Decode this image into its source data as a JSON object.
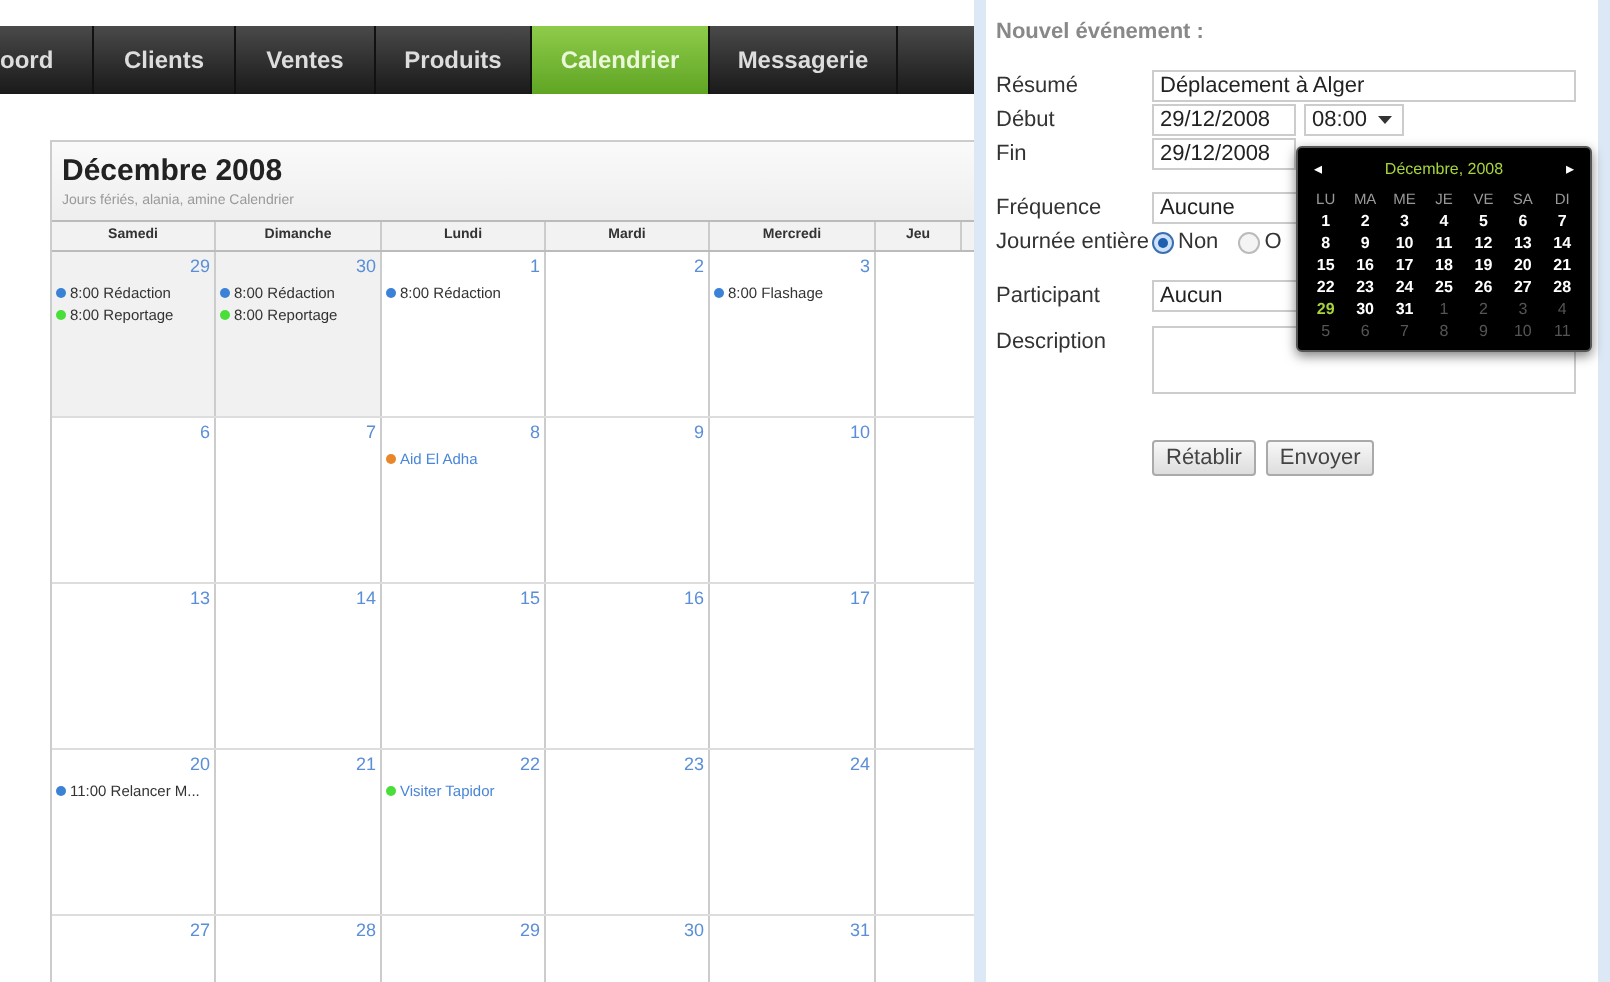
{
  "nav": {
    "tabs": [
      {
        "label": "oord",
        "selected": false
      },
      {
        "label": "Clients",
        "selected": false
      },
      {
        "label": "Ventes",
        "selected": false
      },
      {
        "label": "Produits",
        "selected": false
      },
      {
        "label": "Calendrier",
        "selected": true
      },
      {
        "label": "Messagerie",
        "selected": false
      }
    ]
  },
  "calendar": {
    "title": "Décembre 2008",
    "subtitle": "Jours fériés, alania, amine Calendrier",
    "columns": [
      "Samedi",
      "Dimanche",
      "Lundi",
      "Mardi",
      "Mercredi",
      "Jeu"
    ],
    "weeks": [
      {
        "days": [
          {
            "number": "29",
            "past": true,
            "events": [
              {
                "kind": "event",
                "text": "8:00 Rédaction",
                "color": "#3b82d6"
              },
              {
                "kind": "event",
                "text": "8:00 Reportage",
                "color": "#4ade3a"
              }
            ]
          },
          {
            "number": "30",
            "past": true,
            "events": [
              {
                "kind": "event",
                "text": "8:00 Rédaction",
                "color": "#3b82d6"
              },
              {
                "kind": "event",
                "text": "8:00 Reportage",
                "color": "#4ade3a"
              }
            ]
          },
          {
            "number": "1",
            "past": false,
            "events": [
              {
                "kind": "event",
                "text": "8:00 Rédaction",
                "color": "#3b82d6"
              }
            ]
          },
          {
            "number": "2",
            "past": false
          },
          {
            "number": "3",
            "past": false,
            "events": [
              {
                "kind": "event",
                "text": "8:00 Flashage",
                "color": "#3b82d6"
              }
            ]
          }
        ]
      },
      {
        "days": [
          {
            "number": "6",
            "past": false
          },
          {
            "number": "7",
            "past": false
          },
          {
            "number": "8",
            "past": false,
            "events": [
              {
                "kind": "holiday",
                "text": "Aid El Adha",
                "color": "#e8862a"
              }
            ]
          },
          {
            "number": "9",
            "past": false
          },
          {
            "number": "10",
            "past": false
          }
        ]
      },
      {
        "days": [
          {
            "number": "13",
            "past": false
          },
          {
            "number": "14",
            "past": false
          },
          {
            "number": "15",
            "past": false
          },
          {
            "number": "16",
            "past": false
          },
          {
            "number": "17",
            "past": false
          }
        ]
      },
      {
        "days": [
          {
            "number": "20",
            "past": false,
            "events": [
              {
                "kind": "event",
                "text": "11:00 Relancer M...",
                "color": "#3b82d6"
              }
            ]
          },
          {
            "number": "21",
            "past": false
          },
          {
            "number": "22",
            "past": false,
            "events": [
              {
                "kind": "holiday",
                "text": "Visiter Tapidor",
                "color": "#4ade3a"
              }
            ]
          },
          {
            "number": "23",
            "past": false
          },
          {
            "number": "24",
            "past": false
          }
        ]
      },
      {
        "days": [
          {
            "number": "27",
            "past": false
          },
          {
            "number": "28",
            "past": false
          },
          {
            "number": "29",
            "past": false
          },
          {
            "number": "30",
            "past": false
          },
          {
            "number": "31",
            "past": false
          }
        ]
      }
    ]
  },
  "form": {
    "title": "Nouvel événement :",
    "summary": {
      "label": "Résumé",
      "value": "Déplacement à Alger"
    },
    "start": {
      "label": "Début",
      "date": "29/12/2008",
      "time": "08:00"
    },
    "end": {
      "label": "Fin",
      "date": "29/12/2008"
    },
    "frequency": {
      "label": "Fréquence",
      "value": "Aucune"
    },
    "all_day": {
      "label": "Journée entière",
      "options": [
        {
          "label": "Non",
          "selected": true
        },
        {
          "label": "O",
          "selected": false
        }
      ]
    },
    "participant": {
      "label": "Participant",
      "value": "Aucun"
    },
    "description": {
      "label": "Description"
    },
    "buttons": [
      "Rétablir",
      "Envoyer"
    ]
  },
  "datepicker": {
    "prev": "◂",
    "title": "Décembre, 2008",
    "next": "▸",
    "weekdays": [
      "LU",
      "MA",
      "ME",
      "JE",
      "VE",
      "SA",
      "DI"
    ],
    "weeks": [
      [
        {
          "label": "1",
          "muted": false,
          "selected": false
        },
        {
          "label": "2",
          "muted": false,
          "selected": false
        },
        {
          "label": "3",
          "muted": false,
          "selected": false
        },
        {
          "label": "4",
          "muted": false,
          "selected": false
        },
        {
          "label": "5",
          "muted": false,
          "selected": false
        },
        {
          "label": "6",
          "muted": false,
          "selected": false
        },
        {
          "label": "7",
          "muted": false,
          "selected": false
        }
      ],
      [
        {
          "label": "8",
          "muted": false,
          "selected": false
        },
        {
          "label": "9",
          "muted": false,
          "selected": false
        },
        {
          "label": "10",
          "muted": false,
          "selected": false
        },
        {
          "label": "11",
          "muted": false,
          "selected": false
        },
        {
          "label": "12",
          "muted": false,
          "selected": false
        },
        {
          "label": "13",
          "muted": false,
          "selected": false
        },
        {
          "label": "14",
          "muted": false,
          "selected": false
        }
      ],
      [
        {
          "label": "15",
          "muted": false,
          "selected": false
        },
        {
          "label": "16",
          "muted": false,
          "selected": false
        },
        {
          "label": "17",
          "muted": false,
          "selected": false
        },
        {
          "label": "18",
          "muted": false,
          "selected": false
        },
        {
          "label": "19",
          "muted": false,
          "selected": false
        },
        {
          "label": "20",
          "muted": false,
          "selected": false
        },
        {
          "label": "21",
          "muted": false,
          "selected": false
        }
      ],
      [
        {
          "label": "22",
          "muted": false,
          "selected": false
        },
        {
          "label": "23",
          "muted": false,
          "selected": false
        },
        {
          "label": "24",
          "muted": false,
          "selected": false
        },
        {
          "label": "25",
          "muted": false,
          "selected": false
        },
        {
          "label": "26",
          "muted": false,
          "selected": false
        },
        {
          "label": "27",
          "muted": false,
          "selected": false
        },
        {
          "label": "28",
          "muted": false,
          "selected": false
        }
      ],
      [
        {
          "label": "29",
          "muted": false,
          "selected": true
        },
        {
          "label": "30",
          "muted": false,
          "selected": false
        },
        {
          "label": "31",
          "muted": false,
          "selected": false
        },
        {
          "label": "1",
          "muted": true,
          "selected": false
        },
        {
          "label": "2",
          "muted": true,
          "selected": false
        },
        {
          "label": "3",
          "muted": true,
          "selected": false
        },
        {
          "label": "4",
          "muted": true,
          "selected": false
        }
      ],
      [
        {
          "label": "5",
          "muted": true,
          "selected": false
        },
        {
          "label": "6",
          "muted": true,
          "selected": false
        },
        {
          "label": "7",
          "muted": true,
          "selected": false
        },
        {
          "label": "8",
          "muted": true,
          "selected": false
        },
        {
          "label": "9",
          "muted": true,
          "selected": false
        },
        {
          "label": "10",
          "muted": true,
          "selected": false
        },
        {
          "label": "11",
          "muted": true,
          "selected": false
        }
      ]
    ]
  }
}
